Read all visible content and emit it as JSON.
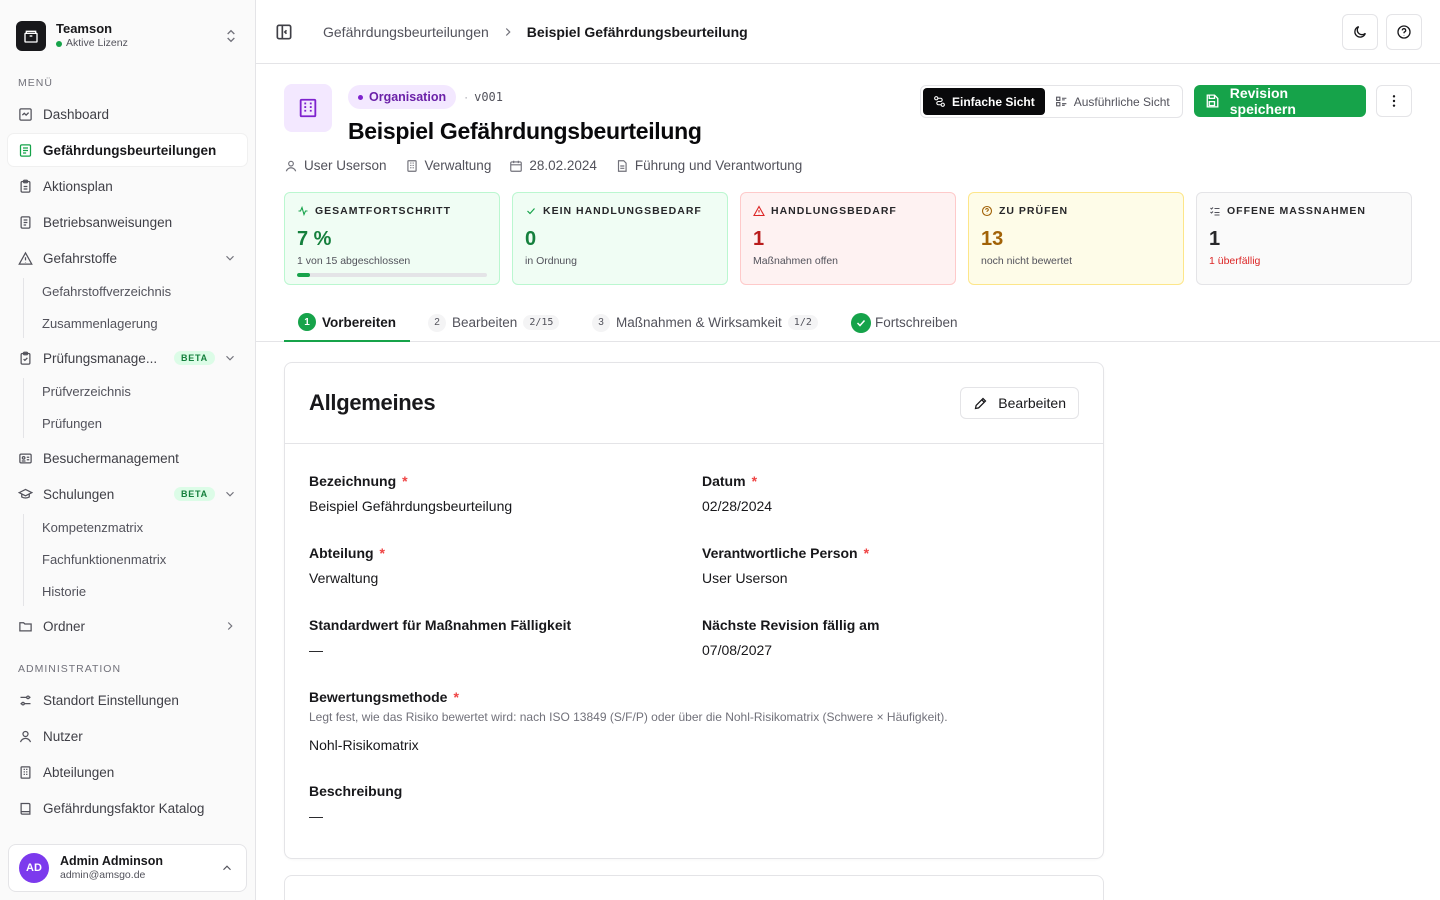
{
  "sidebar": {
    "org_name": "Teamson",
    "org_license": "Aktive Lizenz",
    "menu_label": "MENÜ",
    "items": [
      {
        "label": "Dashboard"
      },
      {
        "label": "Gefährdungsbeurteilungen"
      },
      {
        "label": "Aktionsplan"
      },
      {
        "label": "Betriebsanweisungen"
      },
      {
        "label": "Gefahrstoffe"
      },
      {
        "label": "Prüfungsmanage..."
      },
      {
        "label": "Besuchermanagement"
      },
      {
        "label": "Schulungen"
      },
      {
        "label": "Ordner"
      }
    ],
    "gefahrstoffe_sub": [
      "Gefahrstoffverzeichnis",
      "Zusammenlagerung"
    ],
    "pruefung_sub": [
      "Prüfverzeichnis",
      "Prüfungen"
    ],
    "schulungen_sub": [
      "Kompetenzmatrix",
      "Fachfunktionenmatrix",
      "Historie"
    ],
    "beta_label": "BETA",
    "admin_label": "ADMINISTRATION",
    "admin_items": [
      {
        "label": "Standort Einstellungen"
      },
      {
        "label": "Nutzer"
      },
      {
        "label": "Abteilungen"
      },
      {
        "label": "Gefährdungsfaktor Katalog"
      }
    ],
    "user": {
      "initials": "AD",
      "name": "Admin Adminson",
      "email": "admin@amsgo.de"
    }
  },
  "topbar": {
    "breadcrumb_parent": "Gefährdungsbeurteilungen",
    "breadcrumb_current": "Beispiel Gefährdungsbeurteilung"
  },
  "header": {
    "badge": "Organisation",
    "separator": "·",
    "version": "v001",
    "title": "Beispiel Gefährdungsbeurteilung",
    "person": "User Userson",
    "department": "Verwaltung",
    "date": "28.02.2024",
    "category": "Führung und Verantwortung",
    "view_simple": "Einfache Sicht",
    "view_detailed": "Ausführliche Sicht",
    "save_label": "Revision speichern"
  },
  "kpis": [
    {
      "title": "GESAMTFORTSCHRITT",
      "value": "7 %",
      "sub": "1 von 15 abgeschlossen",
      "progress": 0.07
    },
    {
      "title": "KEIN HANDLUNGSBEDARF",
      "value": "0",
      "sub": "in Ordnung"
    },
    {
      "title": "HANDLUNGSBEDARF",
      "value": "1",
      "sub": "Maßnahmen offen"
    },
    {
      "title": "ZU PRÜFEN",
      "value": "13",
      "sub": "noch nicht bewertet"
    },
    {
      "title": "OFFENE MASSNAHMEN",
      "value": "1",
      "sub": "1 überfällig"
    }
  ],
  "tabs": [
    {
      "num": "1",
      "label": "Vorbereiten"
    },
    {
      "num": "2",
      "label": "Bearbeiten",
      "count": "2/15"
    },
    {
      "num": "3",
      "label": "Maßnahmen & Wirksamkeit",
      "count": "1/2"
    },
    {
      "label": "Fortschreiben"
    }
  ],
  "card": {
    "title": "Allgemeines",
    "edit_label": "Bearbeiten",
    "required_mark": "*",
    "fields": {
      "bezeichnung": {
        "label": "Bezeichnung",
        "value": "Beispiel Gefährdungsbeurteilung"
      },
      "datum": {
        "label": "Datum",
        "value": "02/28/2024"
      },
      "abteilung": {
        "label": "Abteilung",
        "value": "Verwaltung"
      },
      "verantwortlich": {
        "label": "Verantwortliche Person",
        "value": "User Userson"
      },
      "standardwert": {
        "label": "Standardwert für Maßnahmen Fälligkeit",
        "value": "—"
      },
      "revision": {
        "label": "Nächste Revision fällig am",
        "value": "07/08/2027"
      },
      "methode": {
        "label": "Bewertungsmethode",
        "help": "Legt fest, wie das Risiko bewertet wird: nach ISO 13849 (S/F/P) oder über die Nohl-Risikomatrix (Schwere × Häufigkeit).",
        "value": "Nohl-Risikomatrix"
      },
      "beschreibung": {
        "label": "Beschreibung",
        "value": "—"
      }
    }
  },
  "colors": {
    "accent": "#16a34a",
    "purple": "#7e22ce",
    "danger": "#dc2626",
    "warning": "#a16207"
  }
}
